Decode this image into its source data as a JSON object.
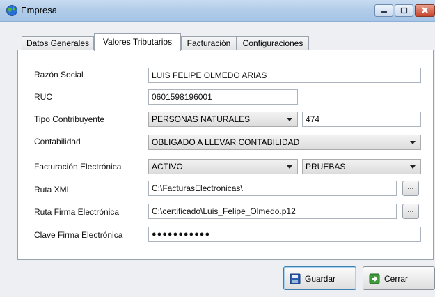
{
  "window": {
    "title": "Empresa",
    "icon": "globe-icon"
  },
  "tabs": [
    {
      "label": "Datos Generales",
      "active": false
    },
    {
      "label": "Valores Tributarios",
      "active": true
    },
    {
      "label": "Facturación",
      "active": false
    },
    {
      "label": "Configuraciones",
      "active": false
    }
  ],
  "form": {
    "razon_social": {
      "label": "Razón Social",
      "value": "LUIS FELIPE OLMEDO ARIAS"
    },
    "ruc": {
      "label": "RUC",
      "value": "0601598196001"
    },
    "tipo_contribuyente": {
      "label": "Tipo Contribuyente",
      "value": "PERSONAS NATURALES",
      "code": "474"
    },
    "contabilidad": {
      "label": "Contabilidad",
      "value": "OBLIGADO A LLEVAR CONTABILIDAD"
    },
    "facturacion_electronica": {
      "label": "Facturación Electrónica",
      "value": "ACTIVO",
      "ambiente": "PRUEBAS"
    },
    "ruta_xml": {
      "label": "Ruta XML",
      "value": "C:\\FacturasElectronicas\\",
      "browse": "..."
    },
    "ruta_firma": {
      "label": "Ruta Firma Electrónica",
      "value": "C:\\certificado\\Luis_Felipe_Olmedo.p12",
      "browse": "..."
    },
    "clave_firma": {
      "label": "Clave Firma Electrónica",
      "value": "●●●●●●●●●●●"
    }
  },
  "buttons": {
    "save": "Guardar",
    "close": "Cerrar"
  },
  "colors": {
    "titlebar": "#b3cde9",
    "window_bg": "#eeeff3",
    "close_button": "#c7452c"
  }
}
